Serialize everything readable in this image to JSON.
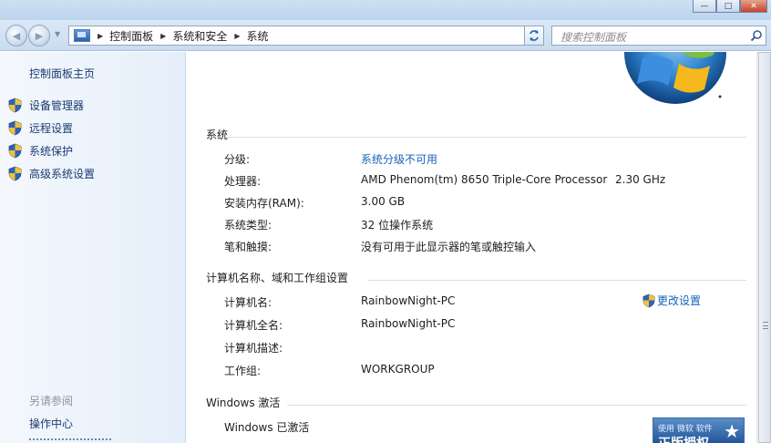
{
  "window": {
    "minimize_glyph": "—",
    "maximize_glyph": "□",
    "close_glyph": "✕"
  },
  "nav": {
    "back_glyph": "◀",
    "forward_glyph": "▶",
    "breadcrumbs": [
      "控制面板",
      "系统和安全",
      "系统"
    ],
    "search_placeholder": "搜索控制面板"
  },
  "sidebar": {
    "home_link": "控制面板主页",
    "tasks": [
      {
        "label": "设备管理器",
        "icon": "shield-icon"
      },
      {
        "label": "远程设置",
        "icon": "shield-icon"
      },
      {
        "label": "系统保护",
        "icon": "shield-icon"
      },
      {
        "label": "高级系统设置",
        "icon": "shield-icon"
      }
    ],
    "see_also": {
      "heading": "另请参阅",
      "links": [
        "操作中心"
      ]
    }
  },
  "system": {
    "heading": "系统",
    "rows": [
      {
        "label": "分级:",
        "value": "系统分级不可用",
        "is_link": true
      },
      {
        "label": "处理器:",
        "value": "AMD Phenom(tm) 8650 Triple-Core Processor",
        "extra": "2.30 GHz"
      },
      {
        "label": "安装内存(RAM):",
        "value": "3.00 GB"
      },
      {
        "label": "系统类型:",
        "value": "32 位操作系统"
      },
      {
        "label": "笔和触摸:",
        "value": "没有可用于此显示器的笔或触控输入"
      }
    ]
  },
  "computer_name": {
    "heading": "计算机名称、域和工作组设置",
    "change_settings_label": "更改设置",
    "rows": [
      {
        "label": "计算机名:",
        "value": "RainbowNight-PC"
      },
      {
        "label": "计算机全名:",
        "value": "RainbowNight-PC"
      },
      {
        "label": "计算机描述:",
        "value": ""
      },
      {
        "label": "工作组:",
        "value": "WORKGROUP"
      }
    ]
  },
  "activation": {
    "heading": "Windows 激活",
    "status": "Windows 已激活",
    "badge_top": "使用 微软 软件",
    "badge_bottom": "正版授权"
  },
  "colors": {
    "link": "#1863b8",
    "sidebar_link": "#1b3a73",
    "sidebar_bg": "#e4eef9"
  }
}
